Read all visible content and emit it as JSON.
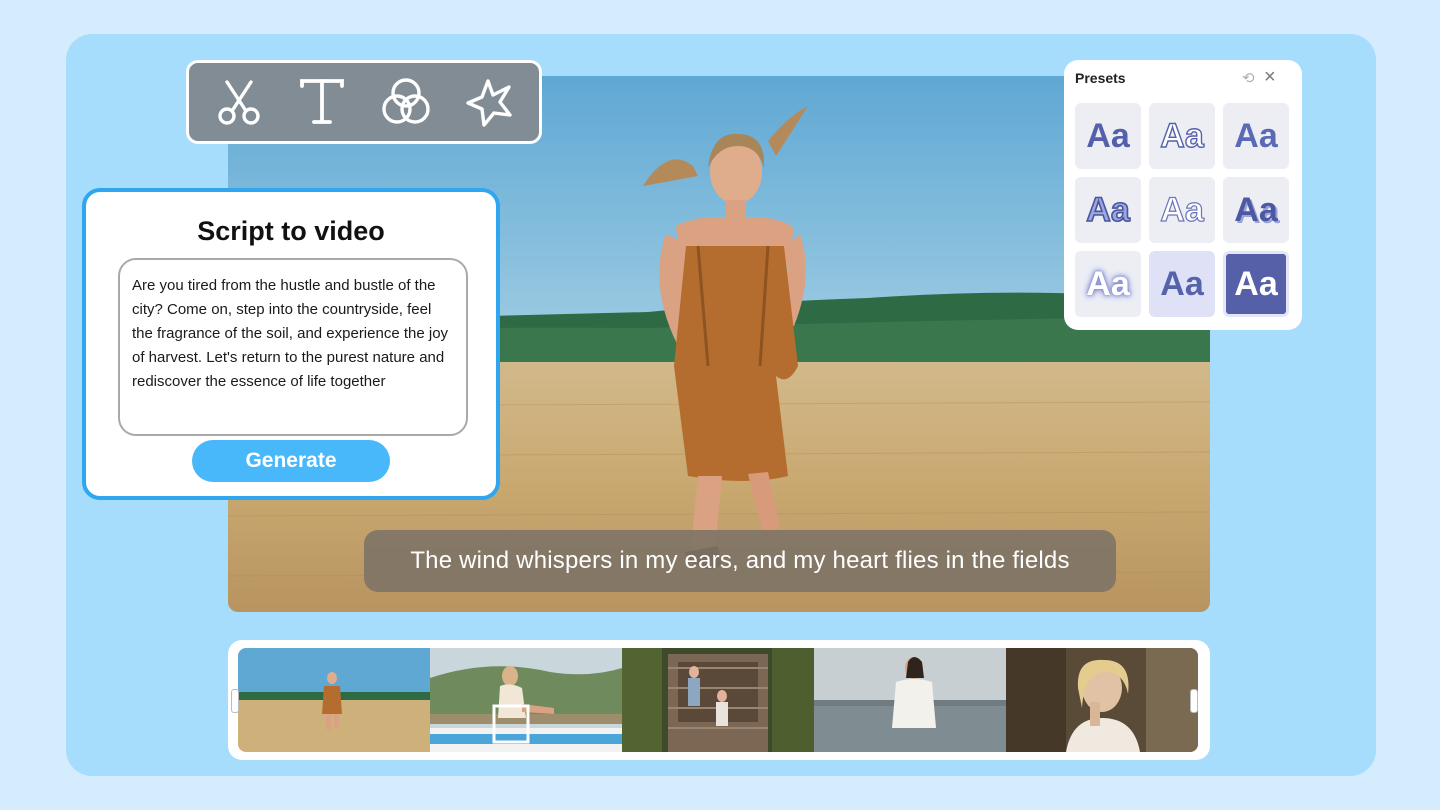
{
  "toolbar": {
    "tools": [
      {
        "icon": "scissors-icon",
        "label": "cut"
      },
      {
        "icon": "text-icon",
        "label": "text"
      },
      {
        "icon": "filter-icon",
        "label": "filters"
      },
      {
        "icon": "effects-icon",
        "label": "effects"
      }
    ]
  },
  "script_card": {
    "title": "Script to video",
    "script_text": "Are you tired from the hustle and bustle of the city? Come on, step into the countryside, feel the fragrance of the soil, and experience the joy of harvest. Let's return to the purest nature and rediscover the essence of life together",
    "generate_label": "Generate"
  },
  "preview": {
    "subtitle": "The wind whispers in my ears, and my heart flies in the fields"
  },
  "presets": {
    "title": "Presets",
    "items": [
      "Aa",
      "Aa",
      "Aa",
      "Aa",
      "Aa",
      "Aa",
      "Aa",
      "Aa",
      "Aa"
    ],
    "selected_index": 8
  },
  "timeline": {
    "clip_count": 5
  },
  "colors": {
    "page_bg": "#d4ecfd",
    "panel_bg": "#a6dcfc",
    "accent": "#2fa6ef",
    "button": "#48b8fb",
    "preset_ink": "#5460ac"
  }
}
